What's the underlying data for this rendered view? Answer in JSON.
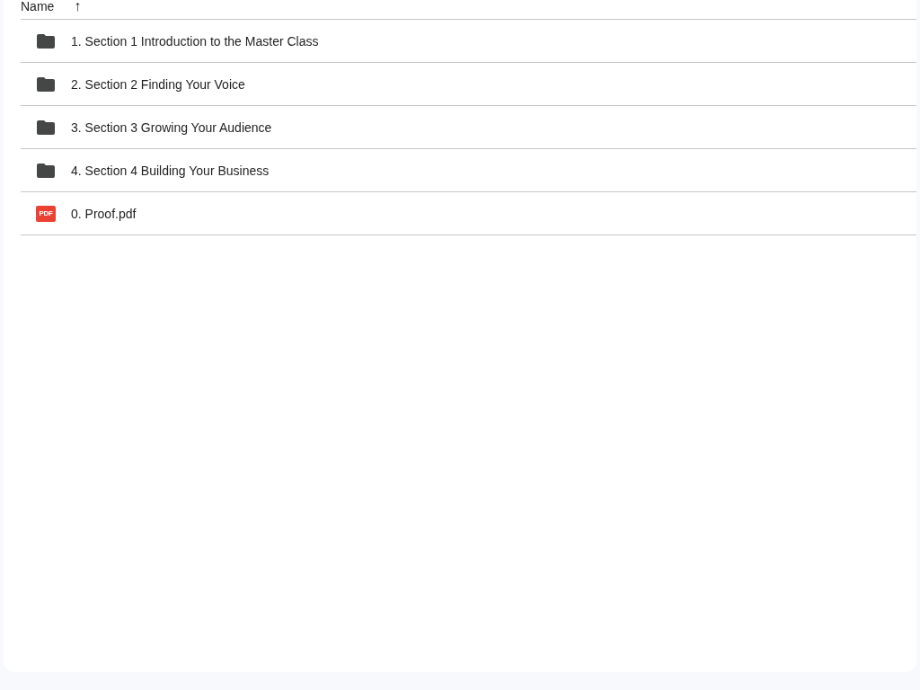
{
  "header": {
    "column": "Name",
    "sort_icon": "↑"
  },
  "files": [
    {
      "kind": "folder",
      "name": "1. Section 1 Introduction to the Master Class"
    },
    {
      "kind": "folder",
      "name": "2. Section 2 Finding Your Voice"
    },
    {
      "kind": "folder",
      "name": "3. Section 3 Growing Your Audience"
    },
    {
      "kind": "folder",
      "name": "4. Section 4 Building Your Business"
    },
    {
      "kind": "pdf",
      "name": "0. Proof.pdf",
      "icon_label": "PDF"
    }
  ]
}
